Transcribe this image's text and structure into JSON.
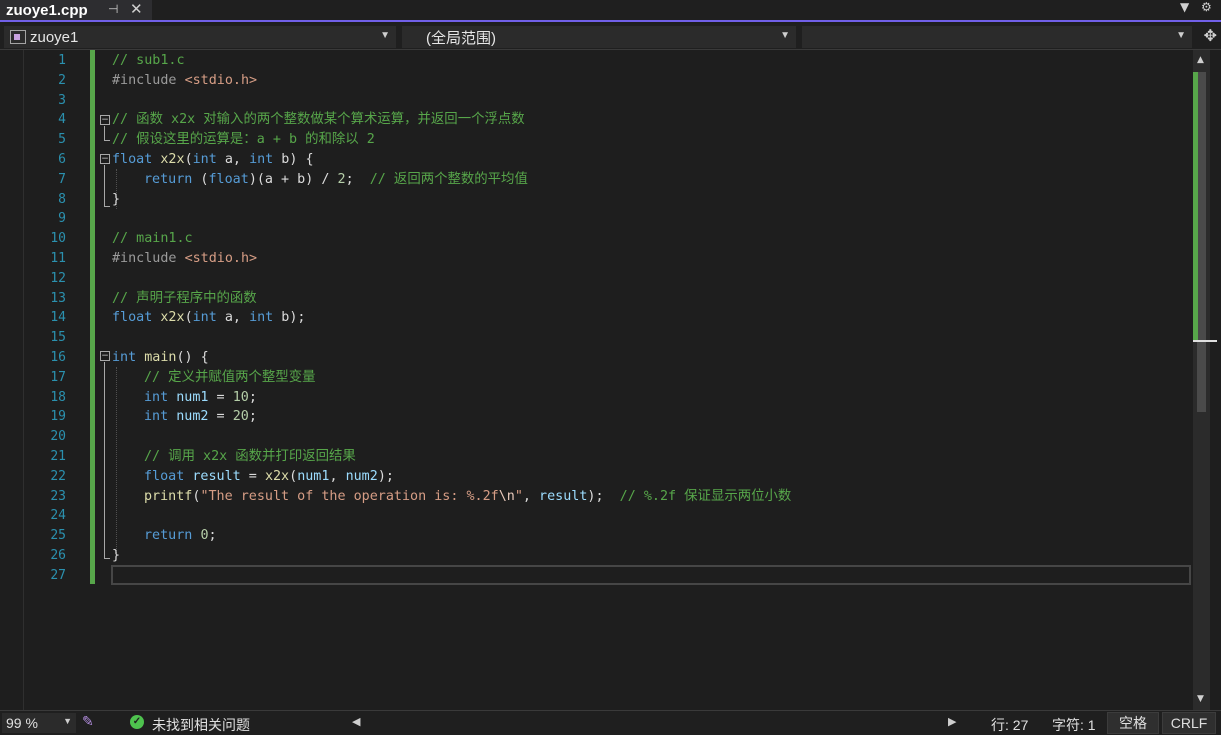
{
  "tab": {
    "title": "zuoye1.cpp",
    "pin_icon": "pin-icon",
    "close_icon": "close-icon"
  },
  "navbar": {
    "project": "zuoye1",
    "scope": "(全局范围)",
    "member": ""
  },
  "editor": {
    "line_numbers": [
      "1",
      "2",
      "3",
      "4",
      "5",
      "6",
      "7",
      "8",
      "9",
      "10",
      "11",
      "12",
      "13",
      "14",
      "15",
      "16",
      "17",
      "18",
      "19",
      "20",
      "21",
      "22",
      "23",
      "24",
      "25",
      "26",
      "27"
    ],
    "code": {
      "l1": "// sub1.c",
      "l2_directive": "#include ",
      "l2_header": "<stdio.h>",
      "l4": "// 函数 x2x 对输入的两个整数做某个算术运算，并返回一个浮点数",
      "l5": "// 假设这里的运算是：a + b 的和除以 2",
      "l6_kw1": "float",
      "l6_fn": "x2x",
      "l6_p1": "(",
      "l6_kw2": "int",
      "l6_a": " a, ",
      "l6_kw3": "int",
      "l6_b": " b) {",
      "l7_kw": "return",
      "l7_p1": " (",
      "l7_kw2": "float",
      "l7_expr": ")(a + b) / ",
      "l7_num": "2",
      "l7_semi": ";  ",
      "l7_cm": "// 返回两个整数的平均值",
      "l8": "}",
      "l10": "// main1.c",
      "l11_directive": "#include ",
      "l11_header": "<stdio.h>",
      "l13": "// 声明子程序中的函数",
      "l14_kw1": "float",
      "l14_fn": "x2x",
      "l14_p1": "(",
      "l14_kw2": "int",
      "l14_a": " a, ",
      "l14_kw3": "int",
      "l14_b": " b);",
      "l16_kw": "int",
      "l16_fn": "main",
      "l16_rest": "() {",
      "l17": "// 定义并赋值两个整型变量",
      "l18_kw": "int",
      "l18_var": "num1",
      "l18_eq": " = ",
      "l18_num": "10",
      "l18_semi": ";",
      "l19_kw": "int",
      "l19_var": "num2",
      "l19_eq": " = ",
      "l19_num": "20",
      "l19_semi": ";",
      "l21": "// 调用 x2x 函数并打印返回结果",
      "l22_kw": "float",
      "l22_var": "result",
      "l22_eq": " = ",
      "l22_fn": "x2x",
      "l22_p1": "(",
      "l22_a1": "num1",
      "l22_comma": ", ",
      "l22_a2": "num2",
      "l22_p2": ");",
      "l23_fn": "printf",
      "l23_p1": "(",
      "l23_str": "\"The result of the operation is: %.2f",
      "l23_esc": "\\n",
      "l23_strend": "\"",
      "l23_comma": ", ",
      "l23_var": "result",
      "l23_p2": ");  ",
      "l23_cm": "// %.2f 保证显示两位小数",
      "l25_kw": "return",
      "l25_sp": " ",
      "l25_num": "0",
      "l25_semi": ";",
      "l26": "}"
    }
  },
  "statusbar": {
    "zoom": "99 %",
    "issues": "未找到相关问题",
    "line": "行: 27",
    "char": "字符: 1",
    "spaces": "空格",
    "eol": "CRLF"
  },
  "colors": {
    "accent": "#7160e8",
    "keyword": "#569cd6",
    "function": "#dcdcaa",
    "comment": "#57a64a",
    "string": "#d69d85",
    "number": "#b5cea8",
    "line_number": "#2b91af"
  }
}
